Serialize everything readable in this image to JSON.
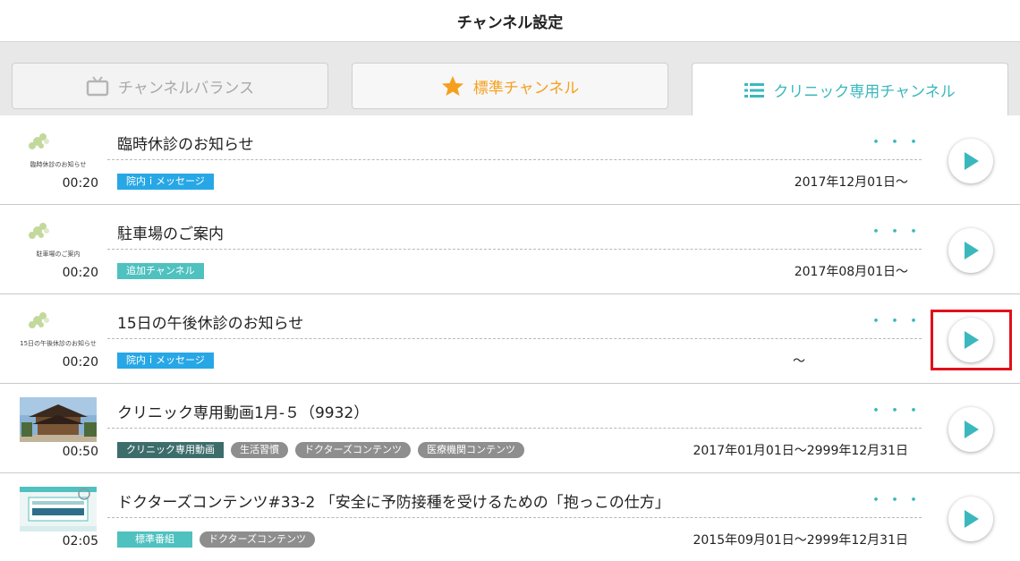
{
  "header": {
    "title": "チャンネル設定"
  },
  "tabs": [
    {
      "label": "チャンネルバランス",
      "icon": "tv-icon"
    },
    {
      "label": "標準チャンネル",
      "icon": "star-icon"
    },
    {
      "label": "クリニック専用チャンネル",
      "icon": "list-icon"
    }
  ],
  "colors": {
    "teal": "#3bb8bd",
    "orange": "#f5a01d",
    "blue_tag": "#27a7e6",
    "teal_tag": "#4fc1bf",
    "dark_tag": "#3d6d6b",
    "gray_tag": "#8e8e8e",
    "highlight": "#e0101a"
  },
  "rows": [
    {
      "thumb_text": "臨時休診のお知らせ",
      "duration": "00:20",
      "title": "臨時休診のお知らせ",
      "more": "・・・",
      "tags": [
        {
          "label": "院内ｉメッセージ"
        }
      ],
      "date": "2017年12月01日〜"
    },
    {
      "thumb_text": "駐車場のご案内",
      "duration": "00:20",
      "title": "駐車場のご案内",
      "more": "・・・",
      "tags": [
        {
          "label": "追加チャンネル"
        }
      ],
      "date": "2017年08月01日〜"
    },
    {
      "thumb_text": "15日の午後休診のお知らせ",
      "duration": "00:20",
      "title": "15日の午後休診のお知らせ",
      "more": "・・・",
      "tags": [
        {
          "label": "院内ｉメッセージ"
        }
      ],
      "date": "〜"
    },
    {
      "thumb_text": "",
      "duration": "00:50",
      "title": "クリニック専用動画1月-５（9932）",
      "more": "・・・",
      "tags": [
        {
          "label": "クリニック専用動画"
        },
        {
          "label": "生活習慣"
        },
        {
          "label": "ドクターズコンテンツ"
        },
        {
          "label": "医療機関コンテンツ"
        }
      ],
      "date": "2017年01月01日〜2999年12月31日"
    },
    {
      "thumb_text": "",
      "duration": "02:05",
      "title": "ドクターズコンテンツ#33-2 「安全に予防接種を受けるための「抱っこの仕方」",
      "more": "・・・",
      "tags": [
        {
          "label": "標準番組"
        },
        {
          "label": "ドクターズコンテンツ"
        }
      ],
      "date": "2015年09月01日〜2999年12月31日"
    }
  ]
}
